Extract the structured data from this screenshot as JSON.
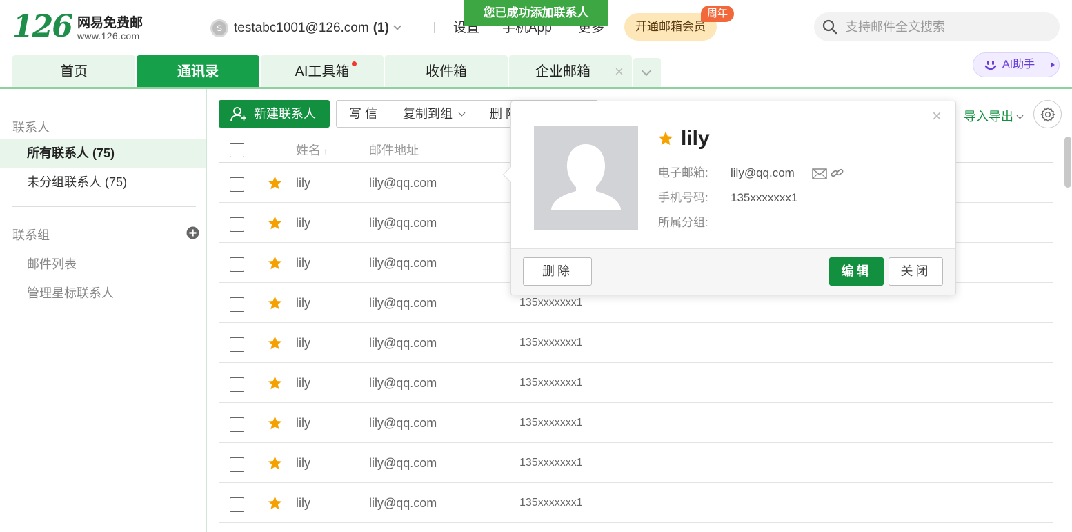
{
  "header": {
    "logo_number": "126",
    "logo_text": "网易免费邮",
    "logo_url": "www.126.com",
    "account_email": "testabc1001@126.com",
    "account_unread": "(1)",
    "settings_label": "设置",
    "mobile_app_label": "手机App",
    "more_label": "更多",
    "toast_text": "您已成功添加联系人",
    "vip_label": "开通邮箱会员",
    "vip_badge": "周年",
    "search_placeholder": "支持邮件全文搜索",
    "ai_label": "AI助手"
  },
  "tabs": [
    {
      "label": "首页",
      "active": false
    },
    {
      "label": "通讯录",
      "active": true
    },
    {
      "label": "AI工具箱",
      "active": false,
      "dot": true
    },
    {
      "label": "收件箱",
      "active": false
    },
    {
      "label": "企业邮箱",
      "active": false,
      "closable": true
    }
  ],
  "sidebar": {
    "contacts_title": "联系人",
    "all_contacts": "所有联系人 (75)",
    "ungrouped_contacts": "未分组联系人 (75)",
    "groups_title": "联系组",
    "mail_list": "邮件列表",
    "manage_starred": "管理星标联系人"
  },
  "toolbar": {
    "new_contact": "新建联系人",
    "write_mail": "写 信",
    "copy_to_group": "复制到组",
    "delete": "删 除",
    "import_export": "导入导出"
  },
  "table": {
    "header_name": "姓名",
    "header_email": "邮件地址",
    "rows": [
      {
        "name": "lily",
        "email": "lily@qq.com",
        "phone": "",
        "starred": true
      },
      {
        "name": "lily",
        "email": "lily@qq.com",
        "phone": "",
        "starred": true
      },
      {
        "name": "lily",
        "email": "lily@qq.com",
        "phone": "",
        "starred": true
      },
      {
        "name": "lily",
        "email": "lily@qq.com",
        "phone": "135xxxxxxx1",
        "starred": true
      },
      {
        "name": "lily",
        "email": "lily@qq.com",
        "phone": "135xxxxxxx1",
        "starred": true
      },
      {
        "name": "lily",
        "email": "lily@qq.com",
        "phone": "135xxxxxxx1",
        "starred": true
      },
      {
        "name": "lily",
        "email": "lily@qq.com",
        "phone": "135xxxxxxx1",
        "starred": true
      },
      {
        "name": "lily",
        "email": "lily@qq.com",
        "phone": "135xxxxxxx1",
        "starred": true
      },
      {
        "name": "lily",
        "email": "lily@qq.com",
        "phone": "135xxxxxxx1",
        "starred": true
      }
    ]
  },
  "popup": {
    "name": "lily",
    "email_label": "电子邮箱:",
    "email_value": "lily@qq.com",
    "phone_label": "手机号码:",
    "phone_value": "135xxxxxxx1",
    "group_label": "所属分组:",
    "group_value": "",
    "delete_label": "删除",
    "edit_label": "编辑",
    "close_label": "关闭",
    "close_icon": "×"
  },
  "colors": {
    "brand_green": "#13903f",
    "tab_active": "#16a04a",
    "tab_bg": "#e8f5ea",
    "toast_green": "#3da744",
    "star": "#f5a100",
    "vip_badge": "#f2683a"
  }
}
